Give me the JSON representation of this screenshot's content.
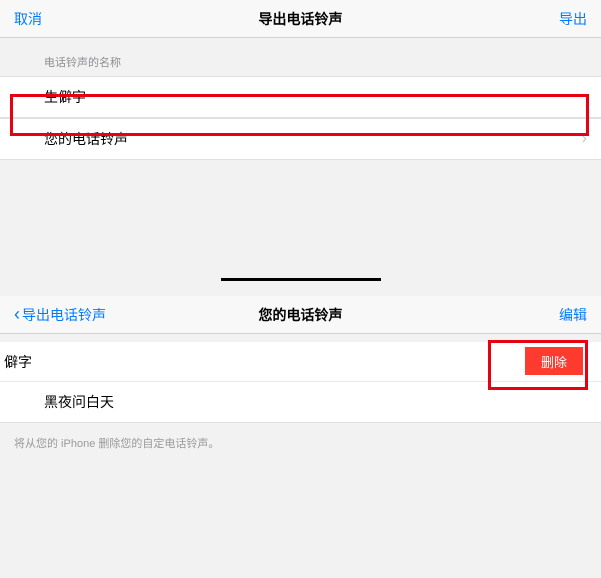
{
  "top": {
    "nav": {
      "cancel": "取消",
      "title": "导出电话铃声",
      "export": "导出"
    },
    "section_label": "电话铃声的名称",
    "name_value": "生僻字",
    "link_label": "您的电话铃声"
  },
  "bottom": {
    "nav": {
      "back": "导出电话铃声",
      "title": "您的电话铃声",
      "edit": "编辑"
    },
    "item1": "僻字",
    "delete": "删除",
    "item2": "黑夜问白天",
    "footer": "将从您的 iPhone 删除您的自定电话铃声。"
  }
}
